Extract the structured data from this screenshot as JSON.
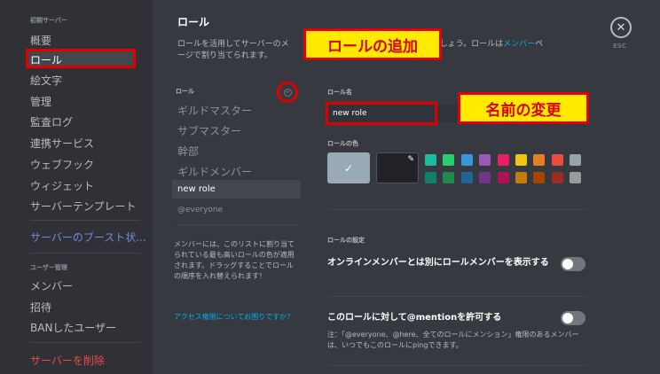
{
  "sidebar": {
    "section_server": "初期サーバー",
    "items": [
      "概要",
      "ロール",
      "絵文字",
      "管理",
      "監査ログ",
      "連携サービス",
      "ウェブフック",
      "ウィジェット",
      "サーバーテンプレート"
    ],
    "boost": "サーバーのブースト状...",
    "section_user": "ユーザー管理",
    "user_items": [
      "メンバー",
      "招待",
      "BANしたユーザー"
    ],
    "delete": "サーバーを削除"
  },
  "main": {
    "title": "ロール",
    "desc_before": "ロールを活用してサーバーのメ",
    "desc_mid": "しましょう。ロールは",
    "desc_link": "メンバー",
    "desc_after": "ページで割り当てられます。",
    "desc_line2": "ージで割り当てられます。",
    "close_label": "ESC"
  },
  "callouts": {
    "add_role": "ロールの追加",
    "rename": "名前の変更"
  },
  "role_list": {
    "header": "ロール",
    "roles": [
      "ギルドマスター",
      "サブマスター",
      "幹部",
      "ギルドメンバー"
    ],
    "selected": "new role",
    "everyone": "@everyone",
    "note": "メンバーには、このリストに割り当てられている最も高いロールの色が適用されます。ドラッグすることでロールの順序を入れ替えられます！",
    "help": "アクセス権限についてお困りですか？"
  },
  "editor": {
    "name_label": "ロール名",
    "name_value": "new role",
    "color_label": "ロールの色",
    "swatches_top": [
      "#1abc9c",
      "#2ecc71",
      "#3498db",
      "#9b59b6",
      "#e91e63",
      "#f1c40f",
      "#e67e22",
      "#e74c3c",
      "#95a5a6"
    ],
    "swatches_bottom": [
      "#11806a",
      "#1f8b4c",
      "#206694",
      "#71368a",
      "#ad1457",
      "#c27c0e",
      "#a84300",
      "#992d22",
      "#979c9f"
    ],
    "settings_label": "ロールの設定",
    "setting1": "オンラインメンバーとは別にロールメンバーを表示する",
    "setting2": "このロールに対して@mentionを許可する",
    "setting2_note": "注：「@everyone、@here、全てのロールにメンション」権限のあるメンバーは、いつでもこのロールにpingできます。"
  }
}
